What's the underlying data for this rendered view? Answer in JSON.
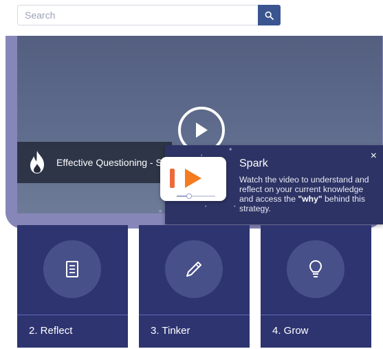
{
  "search": {
    "placeholder": "Search"
  },
  "video": {
    "title": "Effective Questioning - S"
  },
  "spark": {
    "heading": "Spark",
    "body_prefix": "Watch the video to understand and reflect on your current knowledge and access the ",
    "body_bold": "\"why\"",
    "body_suffix": " behind this strategy.",
    "close": "×"
  },
  "cards": [
    {
      "label": "2. Reflect",
      "icon": "document-icon"
    },
    {
      "label": "3. Tinker",
      "icon": "pencil-icon"
    },
    {
      "label": "4. Grow",
      "icon": "lightbulb-icon"
    }
  ],
  "colors": {
    "accent": "#3a5590",
    "card_bg": "#2d3470",
    "popover_bg": "#2d3364",
    "spark_orange": "#f47b20"
  }
}
